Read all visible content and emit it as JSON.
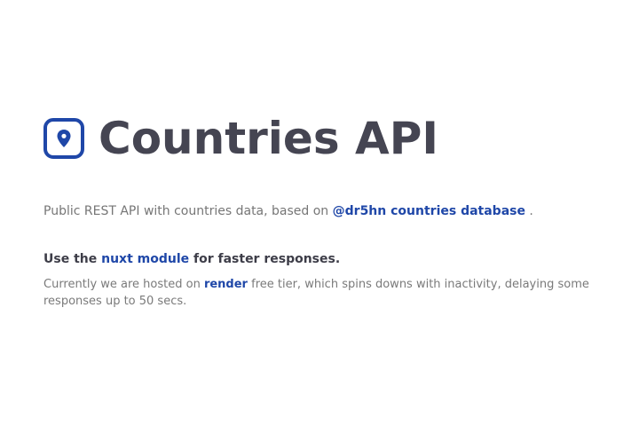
{
  "hero": {
    "title": "Countries API",
    "icon": "map-pin-icon",
    "accent_color": "#1f47a8"
  },
  "intro": {
    "text_before": "Public REST API with countries data, based on ",
    "link_label": "@dr5hn countries database",
    "text_after": " ."
  },
  "module": {
    "text_before": "Use the ",
    "link_label": "nuxt module",
    "text_after": " for faster responses."
  },
  "note": {
    "text_before": "Currently we are hosted on ",
    "link_label": "render",
    "text_after": " free tier, which spins downs with inactivity, delaying some responses up to 50 secs."
  }
}
